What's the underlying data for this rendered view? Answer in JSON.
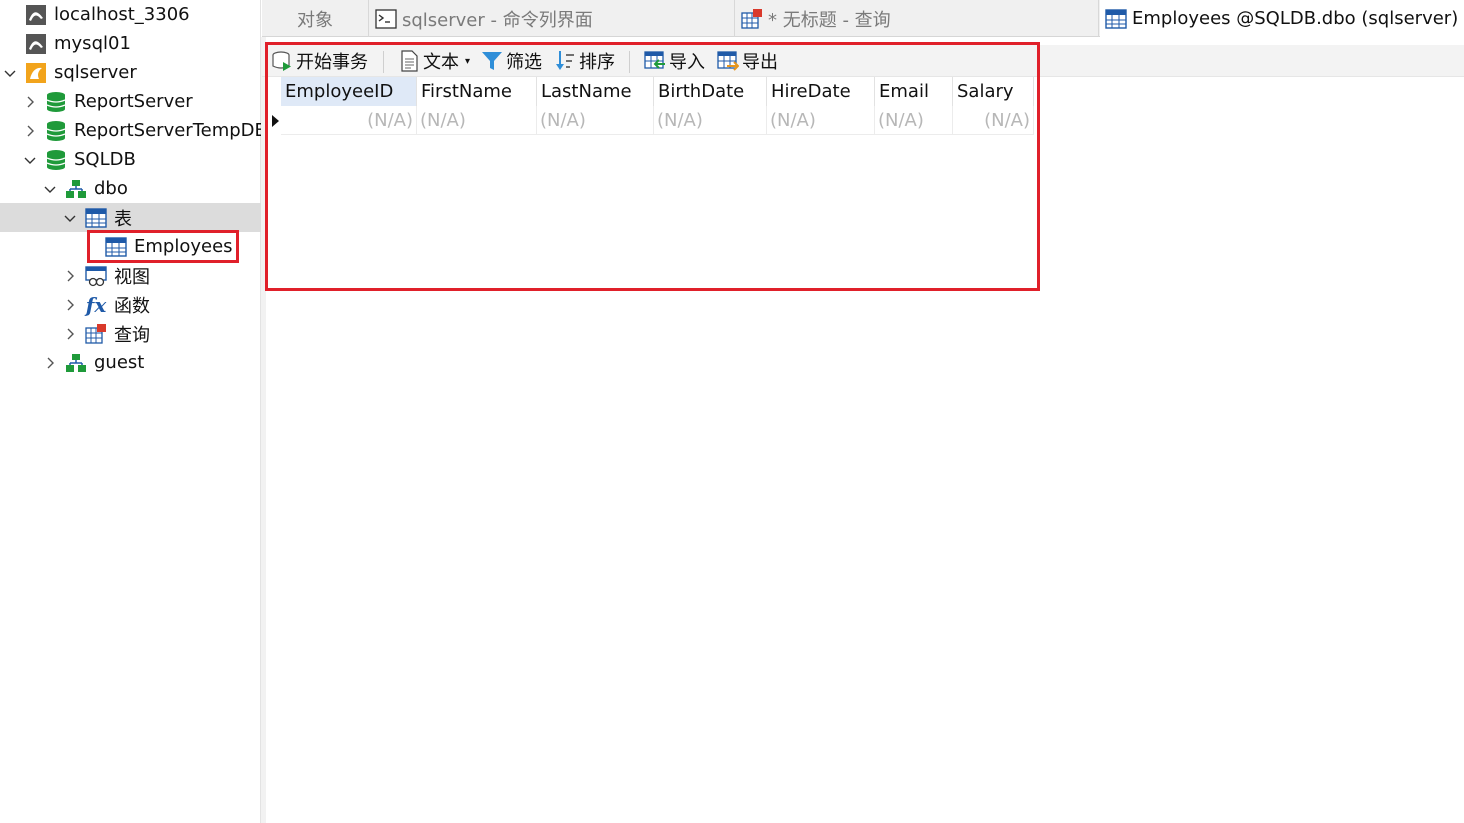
{
  "sidebar": {
    "items": [
      {
        "label": "localhost_3306",
        "icon": "mysql-connection-icon"
      },
      {
        "label": "mysql01",
        "icon": "mysql-connection-icon"
      },
      {
        "label": "sqlserver",
        "icon": "sqlserver-connection-icon",
        "expanded": true
      },
      {
        "label": "ReportServer",
        "icon": "database-icon"
      },
      {
        "label": "ReportServerTempDB",
        "icon": "database-icon"
      },
      {
        "label": "SQLDB",
        "icon": "database-icon",
        "expanded": true
      },
      {
        "label": "dbo",
        "icon": "schema-icon",
        "expanded": true
      },
      {
        "label": "表",
        "icon": "table-icon",
        "expanded": true,
        "selected": true
      },
      {
        "label": "Employees",
        "icon": "table-icon"
      },
      {
        "label": "视图",
        "icon": "view-icon"
      },
      {
        "label": "函数",
        "icon": "function-icon",
        "glyph": "fx"
      },
      {
        "label": "查询",
        "icon": "query-icon"
      },
      {
        "label": "guest",
        "icon": "schema-icon"
      }
    ]
  },
  "tabs": [
    {
      "label": "对象",
      "active": false
    },
    {
      "label": "sqlserver - 命令列界面",
      "icon": "console-icon",
      "active": false
    },
    {
      "label": "* 无标题 - 查询",
      "icon": "query-icon",
      "active": false
    },
    {
      "label": "Employees @SQLDB.dbo (sqlserver) ...",
      "icon": "table-icon",
      "active": true
    }
  ],
  "toolbar": {
    "begin_transaction": "开始事务",
    "text": "文本",
    "filter": "筛选",
    "sort": "排序",
    "import": "导入",
    "export": "导出"
  },
  "grid": {
    "columns": [
      "EmployeeID",
      "FirstName",
      "LastName",
      "BirthDate",
      "HireDate",
      "Email",
      "Salary"
    ],
    "rows": [
      [
        "(N/A)",
        "(N/A)",
        "(N/A)",
        "(N/A)",
        "(N/A)",
        "(N/A)",
        "(N/A)"
      ]
    ]
  },
  "colors": {
    "highlight": "#e0202a",
    "database": "#1f9a3a",
    "selected_header": "#dfe9f7"
  }
}
